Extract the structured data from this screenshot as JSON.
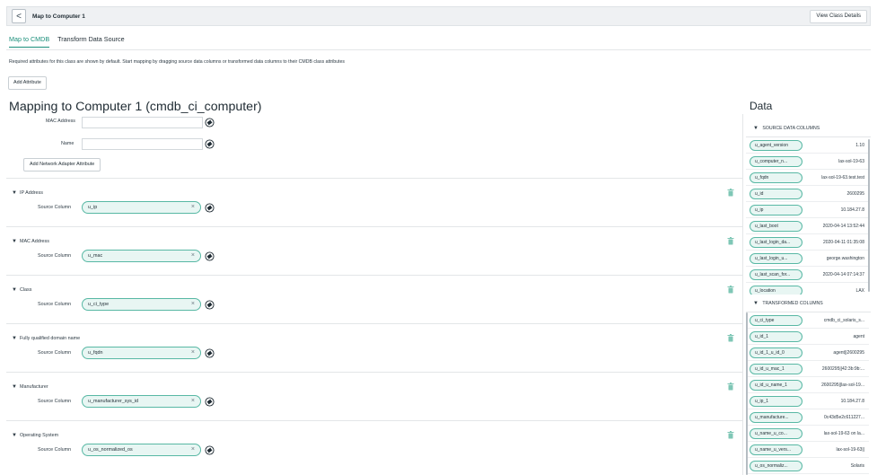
{
  "header": {
    "back_label": "<",
    "title": "Map to Computer 1",
    "view_class_details": "View Class Details"
  },
  "tabs": [
    {
      "label": "Map to CMDB",
      "active": true
    },
    {
      "label": "Transform Data Source",
      "active": false
    }
  ],
  "intro_text": "Required attributes for this class are shown by default. Start mapping by dragging source data columns or transformed data columns to their CMDB class attributes",
  "add_attribute_label": "Add Attribute",
  "main_title": "Mapping to Computer 1 (cmdb_ci_computer)",
  "network_adapter": {
    "mac_label": "MAC Address",
    "name_label": "Name",
    "add_button": "Add Network Adapter Attribute"
  },
  "source_column_label": "Source Column",
  "sections": [
    {
      "title": "IP Address",
      "source": "u_ip"
    },
    {
      "title": "MAC Address",
      "source": "u_mac"
    },
    {
      "title": "Class",
      "source": "u_ci_type"
    },
    {
      "title": "Fully qualified domain name",
      "source": "u_fqdn"
    },
    {
      "title": "Manufacturer",
      "source": "u_manufacturer_sys_id"
    },
    {
      "title": "Operating System",
      "source": "u_os_normalized_os"
    }
  ],
  "data_panel": {
    "title": "Data",
    "source_header": "SOURCE DATA COLUMNS",
    "transformed_header": "TRANSFORMED COLUMNS",
    "source_columns": [
      {
        "name": "u_agent_version",
        "value": "1.10"
      },
      {
        "name": "u_computer_n...",
        "value": "lax-sol-19-63"
      },
      {
        "name": "u_fqdn",
        "value": "lax-sol-19-63.test.test"
      },
      {
        "name": "u_id",
        "value": "2600295"
      },
      {
        "name": "u_ip",
        "value": "10.184.27.8"
      },
      {
        "name": "u_last_boot",
        "value": "2020-04-14 13:52:44"
      },
      {
        "name": "u_last_login_da...",
        "value": "2020-04-11 01:35:08"
      },
      {
        "name": "u_last_login_u...",
        "value": "george.washington"
      },
      {
        "name": "u_last_scan_for...",
        "value": "2020-04-14 07:14:37"
      },
      {
        "name": "u_location",
        "value": "LAX"
      }
    ],
    "transformed_columns": [
      {
        "name": "u_ci_type",
        "value": "cmdb_ci_solaris_s..."
      },
      {
        "name": "u_id_1",
        "value": "agent"
      },
      {
        "name": "u_id_1_u_id_0",
        "value": "agent||2600295"
      },
      {
        "name": "u_id_u_mac_1",
        "value": "2600295||42:3b:9b:..."
      },
      {
        "name": "u_id_u_name_1",
        "value": "2600295||lax-sol-19..."
      },
      {
        "name": "u_ip_1",
        "value": "10.184.27.8"
      },
      {
        "name": "u_manufacture...",
        "value": "0c43d5e2c611227..."
      },
      {
        "name": "u_name_u_co...",
        "value": "lax-sol-19-63 on la..."
      },
      {
        "name": "u_name_u_vers...",
        "value": "lax-sol-19-63||"
      },
      {
        "name": "u_os_normaliz...",
        "value": "Solaris"
      }
    ]
  },
  "colors": {
    "accent": "#1b8f7b",
    "chip_border": "#58b8a4",
    "chip_bg": "#e8f6f3",
    "trash": "#7fc7b6"
  }
}
